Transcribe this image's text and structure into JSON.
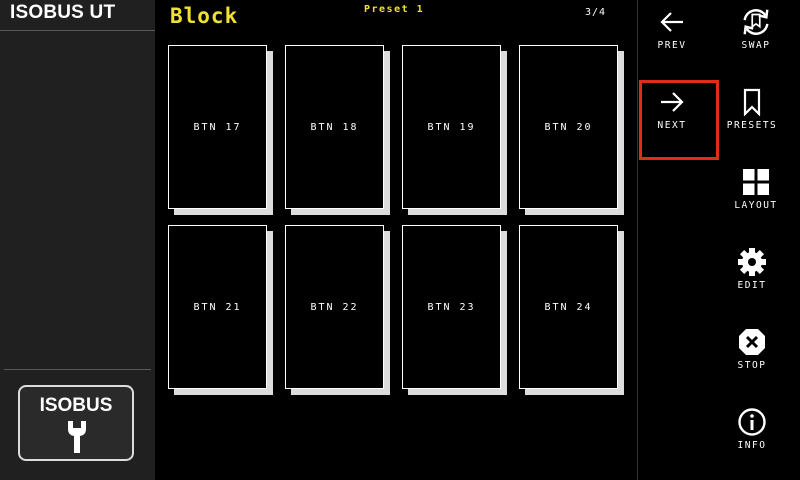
{
  "app": {
    "title": "ISOBUS UT"
  },
  "left": {
    "isobus_label": "ISOBUS"
  },
  "main": {
    "title": "Block",
    "preset": "Preset 1",
    "page": "3/4",
    "buttons": [
      "BTN 17",
      "BTN 18",
      "BTN 19",
      "BTN 20",
      "BTN 21",
      "BTN 22",
      "BTN 23",
      "BTN 24"
    ]
  },
  "sidebar": {
    "prev": "PREV",
    "swap": "SWAP",
    "next": "NEXT",
    "presets": "PRESETS",
    "layout": "LAYOUT",
    "edit": "EDIT",
    "stop": "STOP",
    "info": "INFO"
  },
  "colors": {
    "accent": "#f0e130",
    "highlight": "#e32b1c",
    "panel": "#202020"
  }
}
